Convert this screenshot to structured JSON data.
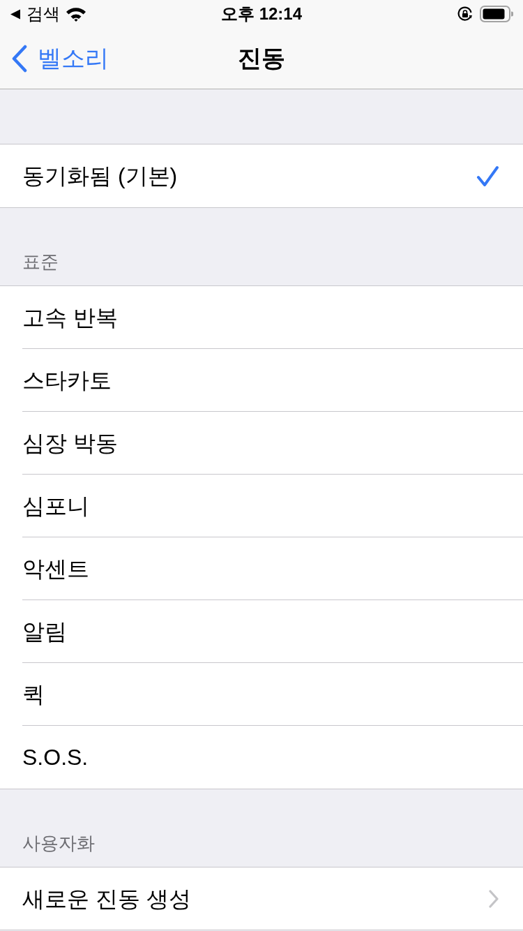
{
  "status_bar": {
    "back_label": "검색",
    "time": "오후 12:14"
  },
  "nav": {
    "back": "벨소리",
    "title": "진동"
  },
  "sections": [
    {
      "items": [
        {
          "kind": "option",
          "label": "동기화됨 (기본)",
          "selected": true
        }
      ]
    },
    {
      "header": "표준",
      "items": [
        {
          "kind": "option",
          "label": "고속 반복",
          "selected": false
        },
        {
          "kind": "option",
          "label": "스타카토",
          "selected": false
        },
        {
          "kind": "option",
          "label": "심장 박동",
          "selected": false
        },
        {
          "kind": "option",
          "label": "심포니",
          "selected": false
        },
        {
          "kind": "option",
          "label": "악센트",
          "selected": false
        },
        {
          "kind": "option",
          "label": "알림",
          "selected": false
        },
        {
          "kind": "option",
          "label": "퀵",
          "selected": false
        },
        {
          "kind": "option",
          "label": "S.O.S.",
          "selected": false
        }
      ]
    },
    {
      "header": "사용자화",
      "items": [
        {
          "kind": "link",
          "label": "새로운 진동 생성"
        }
      ]
    }
  ]
}
